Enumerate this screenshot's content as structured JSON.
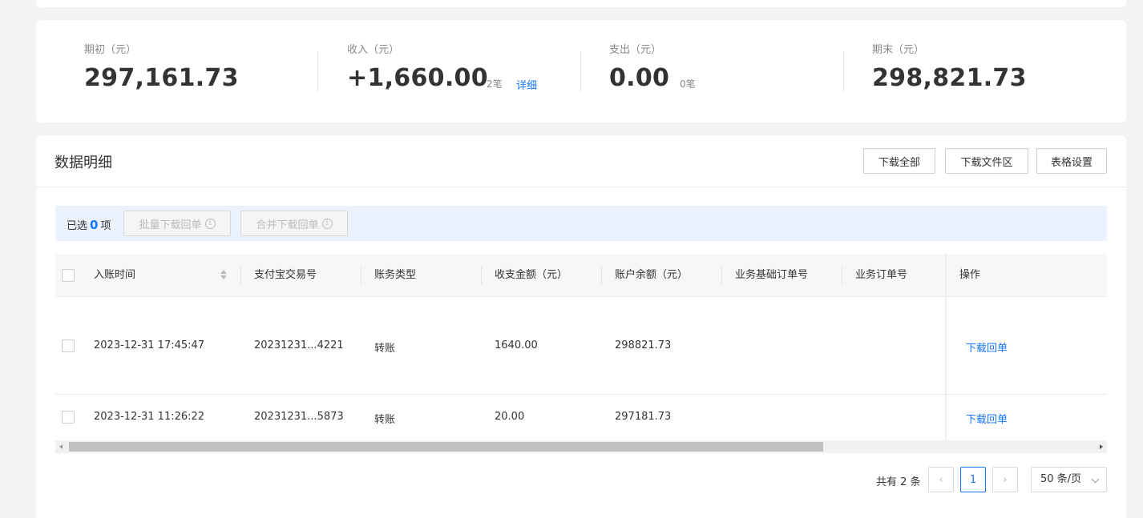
{
  "summary": {
    "opening": {
      "label": "期初（元）",
      "value": "297,161.73"
    },
    "income": {
      "label": "收入（元）",
      "value": "+1,660.00",
      "count": "2笔",
      "detail": "详细"
    },
    "expense": {
      "label": "支出（元）",
      "value": "0.00",
      "count": "0笔"
    },
    "closing": {
      "label": "期末（元）",
      "value": "298,821.73"
    }
  },
  "details": {
    "title": "数据明细",
    "buttons": {
      "download_all": "下载全部",
      "download_files": "下载文件区",
      "table_settings": "表格设置"
    },
    "selection": {
      "prefix": "已选",
      "count": "0",
      "suffix": "项",
      "batch_download": "批量下载回单",
      "merge_download": "合并下载回单"
    },
    "columns": [
      "入账时间",
      "支付宝交易号",
      "账务类型",
      "收支金额（元）",
      "账户余额（元）",
      "业务基础订单号",
      "业务订单号",
      "操作"
    ],
    "rows": [
      {
        "time": "2023-12-31 17:45:47",
        "trade_no": "20231231...4221",
        "type": "转账",
        "amount": "1640.00",
        "balance": "298821.73",
        "base_order": "",
        "order": "",
        "action": "下载回单"
      },
      {
        "time": "2023-12-31 11:26:22",
        "trade_no": "20231231...5873",
        "type": "转账",
        "amount": "20.00",
        "balance": "297181.73",
        "base_order": "",
        "order": "",
        "action": "下载回单"
      }
    ],
    "pagination": {
      "total": "共有 2 条",
      "current": "1",
      "page_size": "50 条/页"
    }
  },
  "colors": {
    "accent": "#1677ff",
    "selection_bar": "#ebf2fd",
    "page_bg": "#f3f3f3"
  }
}
